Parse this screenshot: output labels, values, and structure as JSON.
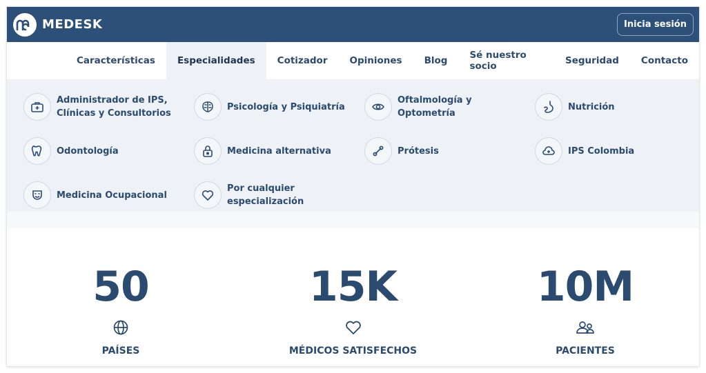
{
  "header": {
    "brand": "MEDESK",
    "login_label": "Inicia sesión"
  },
  "nav": {
    "items": [
      {
        "label": "Características"
      },
      {
        "label": "Especialidades",
        "active": true
      },
      {
        "label": "Cotizador"
      },
      {
        "label": "Opiniones"
      },
      {
        "label": "Blog"
      },
      {
        "label": "Sé nuestro socio"
      },
      {
        "label": "Seguridad"
      },
      {
        "label": "Contacto"
      }
    ]
  },
  "specialties": [
    {
      "label": "Administrador de IPS, Clínicas y Consultorios",
      "icon": "medical-bag-icon"
    },
    {
      "label": "Psicología y Psiquiatría",
      "icon": "brain-icon"
    },
    {
      "label": "Oftalmología y Optometría",
      "icon": "eye-icon"
    },
    {
      "label": "Nutrición",
      "icon": "stomach-icon"
    },
    {
      "label": "Odontología",
      "icon": "tooth-icon"
    },
    {
      "label": "Medicina alternativa",
      "icon": "lock-icon"
    },
    {
      "label": "Prótesis",
      "icon": "bone-icon"
    },
    {
      "label": "IPS Colombia",
      "icon": "medical-cloud-icon"
    },
    {
      "label": "Medicina Ocupacional",
      "icon": "mask-icon"
    },
    {
      "label": "Por cualquier especialización",
      "icon": "heart-icon"
    }
  ],
  "stats": [
    {
      "value": "50",
      "label": "PAÍSES",
      "icon": "globe-icon"
    },
    {
      "value": "15K",
      "label": "MÉDICOS SATISFECHOS",
      "icon": "heart-icon"
    },
    {
      "value": "10M",
      "label": "PACIENTES",
      "icon": "users-icon"
    }
  ],
  "colors": {
    "header_bg": "#2c5077",
    "text": "#2b4a6f",
    "panel_bg": "#eef2f6"
  }
}
